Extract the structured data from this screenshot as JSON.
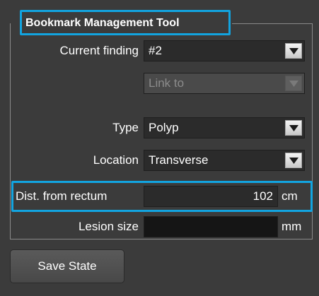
{
  "group": {
    "title": "Bookmark Management Tool"
  },
  "fields": {
    "current_finding": {
      "label": "Current finding",
      "value": "#2"
    },
    "link_to": {
      "value": "Link to",
      "enabled": false
    },
    "type": {
      "label": "Type",
      "value": "Polyp"
    },
    "location": {
      "label": "Location",
      "value": "Transverse"
    },
    "dist_from_rectum": {
      "label": "Dist. from rectum",
      "value": "102",
      "unit": "cm"
    },
    "lesion_size": {
      "label": "Lesion size",
      "value": "",
      "unit": "mm"
    }
  },
  "buttons": {
    "save_state": "Save State"
  },
  "icons": {
    "dropdown": "chevron-down-icon"
  },
  "colors": {
    "highlight": "#12a4e0",
    "panel_bg": "#3b3b3b",
    "field_bg": "#2b2b2b"
  }
}
